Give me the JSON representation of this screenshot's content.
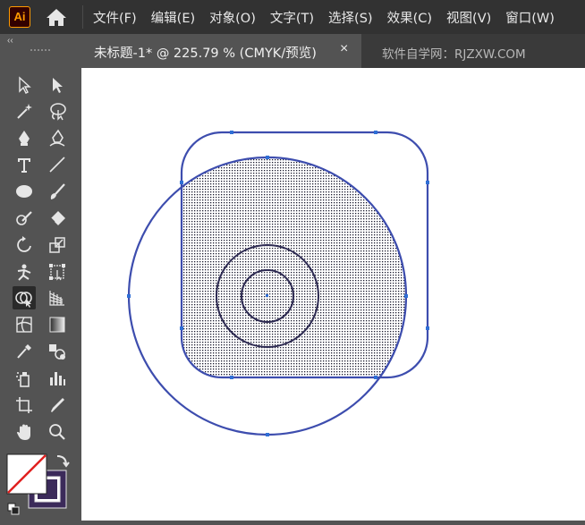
{
  "app": {
    "logo_text": "Ai"
  },
  "menu": {
    "items": [
      "文件(F)",
      "编辑(E)",
      "对象(O)",
      "文字(T)",
      "选择(S)",
      "效果(C)",
      "视图(V)",
      "窗口(W)"
    ]
  },
  "document_tab": {
    "title": "未标题-1* @ 225.79 % (CMYK/预览)",
    "close": "×",
    "inactive_label": "软件自学网：RJZXW.COM"
  },
  "toolbar": {
    "collapse": "‹‹",
    "tools": [
      "selection-tool-icon",
      "direct-selection-tool-icon",
      "magic-wand-tool-icon",
      "lasso-tool-icon",
      "pen-tool-icon",
      "curvature-tool-icon",
      "type-tool-icon",
      "line-segment-tool-icon",
      "ellipse-tool-icon",
      "paintbrush-tool-icon",
      "shaper-tool-icon",
      "eraser-tool-icon",
      "rotate-tool-icon",
      "scale-tool-icon",
      "puppet-warp-tool-icon",
      "free-transform-tool-icon",
      "shape-builder-tool-icon",
      "perspective-grid-tool-icon",
      "mesh-tool-icon",
      "gradient-tool-icon",
      "eyedropper-tool-icon",
      "blend-tool-icon",
      "symbol-sprayer-tool-icon",
      "column-graph-tool-icon",
      "artboard-tool-icon",
      "slice-tool-icon",
      "hand-tool-icon",
      "zoom-tool-icon"
    ],
    "selected_tool": "shape-builder-tool-icon",
    "fill_color": "none",
    "stroke_color": "#3b2a5a"
  },
  "colors": {
    "path_stroke": "#3d4dae",
    "anchor": "#2f6fd6",
    "hatch": "#1a1a2e"
  }
}
